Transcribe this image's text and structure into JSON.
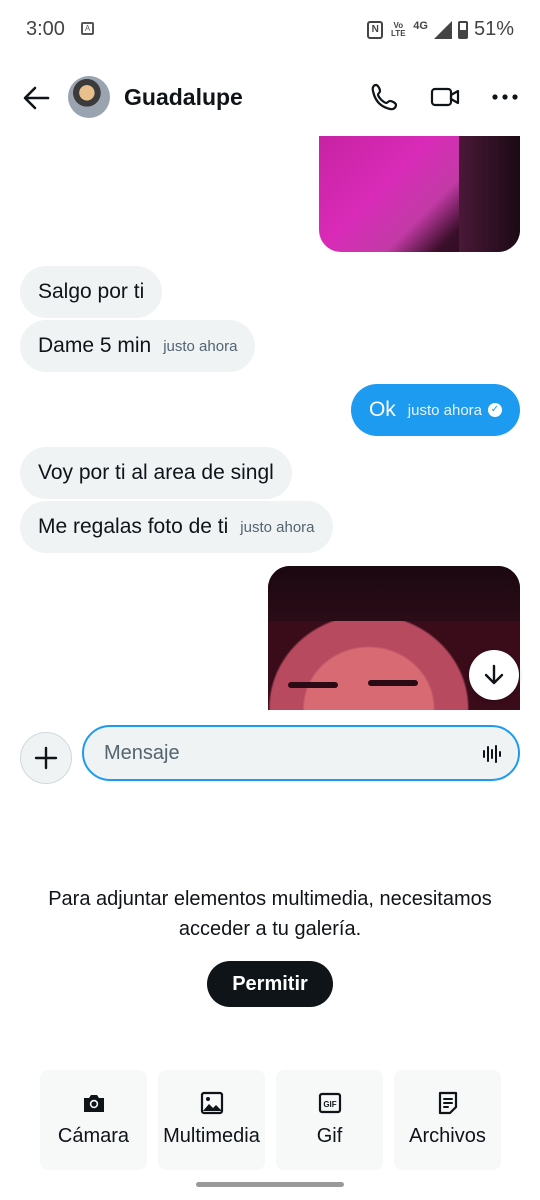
{
  "status_bar": {
    "time": "3:00",
    "network": "4G",
    "volte": "Vo LTE",
    "battery": "51%",
    "nfc": "N"
  },
  "header": {
    "contact_name": "Guadalupe"
  },
  "messages": [
    {
      "direction": "in",
      "text": "Salgo por ti",
      "time": ""
    },
    {
      "direction": "in",
      "text": "Dame 5 min",
      "time": "justo ahora"
    },
    {
      "direction": "out",
      "text": "Ok",
      "time": "justo ahora",
      "status": "read"
    },
    {
      "direction": "in",
      "text": "Voy por ti al area de singl",
      "time": ""
    },
    {
      "direction": "in",
      "text": "Me regalas foto de ti",
      "time": "justo ahora"
    }
  ],
  "composer": {
    "placeholder": "Mensaje"
  },
  "permission": {
    "message": "Para adjuntar elementos multimedia, necesitamos acceder a tu galería.",
    "button_label": "Permitir"
  },
  "attach_options": [
    {
      "label": "Cámara",
      "icon": "camera-icon"
    },
    {
      "label": "Multimedia",
      "icon": "image-icon"
    },
    {
      "label": "Gif",
      "icon": "gif-icon"
    },
    {
      "label": "Archivos",
      "icon": "file-icon"
    }
  ],
  "colors": {
    "accent": "#1d9bf0",
    "incoming_bubble": "#eff3f4",
    "text": "#0f1419",
    "muted": "#536471"
  }
}
